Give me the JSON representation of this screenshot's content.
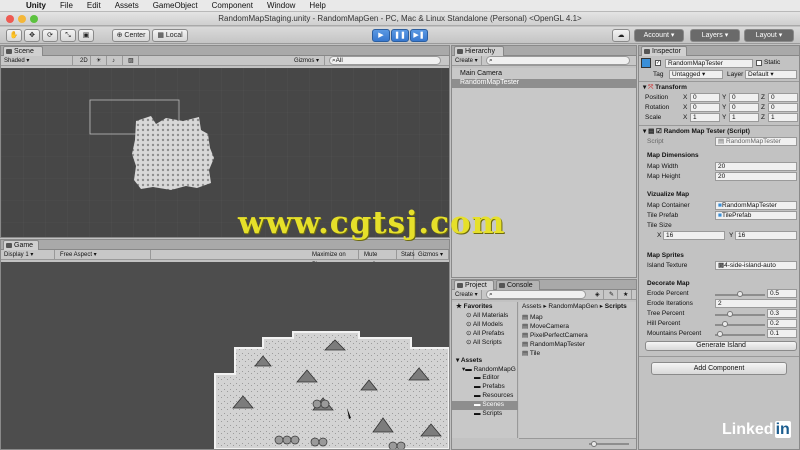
{
  "menubar": {
    "apple_symbol": "",
    "items": [
      "Unity",
      "File",
      "Edit",
      "Assets",
      "GameObject",
      "Component",
      "Window",
      "Help"
    ]
  },
  "window_title": "RandomMapStaging.unity - RandomMapGen - PC, Mac & Linux Standalone (Personal) <OpenGL 4.1>",
  "toolbar": {
    "center_label": "Center",
    "local_label": "Local",
    "account_label": "Account",
    "layers_label": "Layers",
    "layout_label": "Layout"
  },
  "scene": {
    "tab_label": "Scene",
    "shading": "Shaded",
    "mode_2d": "2D",
    "gizmos_label": "Gizmos",
    "search_placeholder": "All"
  },
  "game": {
    "tab_label": "Game",
    "display": "Display 1",
    "aspect": "Free Aspect",
    "maximize": "Maximize on Play",
    "mute": "Mute audio",
    "stats": "Stats",
    "gizmos": "Gizmos"
  },
  "hierarchy": {
    "tab_label": "Hierarchy",
    "create_label": "Create",
    "items": [
      "Main Camera",
      "RandomMapTester"
    ]
  },
  "project": {
    "tab_label": "Project",
    "console_tab_label": "Console",
    "create_label": "Create",
    "favorites_label": "Favorites",
    "favorites": [
      "All Materials",
      "All Models",
      "All Prefabs",
      "All Scripts"
    ],
    "assets_label": "Assets",
    "assets_tree": [
      "RandomMapG",
      "Editor",
      "Prefabs",
      "Resources",
      "Scenes",
      "Scripts"
    ],
    "breadcrumb": [
      "Assets",
      "RandomMapGen",
      "Scripts"
    ],
    "files": [
      "Map",
      "MoveCamera",
      "PixelPerfectCamera",
      "RandomMapTester",
      "Tile"
    ]
  },
  "inspector": {
    "tab_label": "Inspector",
    "object_name": "RandomMapTester",
    "static_label": "Static",
    "tag_label": "Tag",
    "tag_value": "Untagged",
    "layer_label": "Layer",
    "layer_value": "Default",
    "transform": {
      "title": "Transform",
      "rows": [
        {
          "label": "Position",
          "x": "0",
          "y": "0",
          "z": "0"
        },
        {
          "label": "Rotation",
          "x": "0",
          "y": "0",
          "z": "0"
        },
        {
          "label": "Scale",
          "x": "1",
          "y": "1",
          "z": "1"
        }
      ]
    },
    "component": {
      "title": "Random Map Tester (Script)",
      "script_label": "Script",
      "script_value": "RandomMapTester",
      "map_dimensions_header": "Map Dimensions",
      "map_width_label": "Map Width",
      "map_width": "20",
      "map_height_label": "Map Height",
      "map_height": "20",
      "visualize_header": "Vizualize Map",
      "map_container_label": "Map Container",
      "map_container_value": "RandomMapTester",
      "tile_prefab_label": "Tile Prefab",
      "tile_prefab_value": "TilePrefab",
      "tile_size_label": "Tile Size",
      "tile_size_x_label": "X",
      "tile_size_x": "16",
      "tile_size_y_label": "Y",
      "tile_size_y": "16",
      "sprites_header": "Map Sprites",
      "island_texture_label": "Island Texture",
      "island_texture_value": "4-side-island-auto",
      "decorate_header": "Decorate Map",
      "erode_percent_label": "Erode Percent",
      "erode_percent": "0.5",
      "erode_iterations_label": "Erode Iterations",
      "erode_iterations": "2",
      "tree_percent_label": "Tree Percent",
      "tree_percent": "0.3",
      "hill_percent_label": "Hill Percent",
      "hill_percent": "0.2",
      "mountains_percent_label": "Mountains Percent",
      "mountains_percent": "0.1",
      "generate_button": "Generate Island"
    },
    "add_component": "Add Component"
  },
  "watermark": "www.cgtsj.com",
  "brand": {
    "text": "Linked",
    "in": "in"
  }
}
